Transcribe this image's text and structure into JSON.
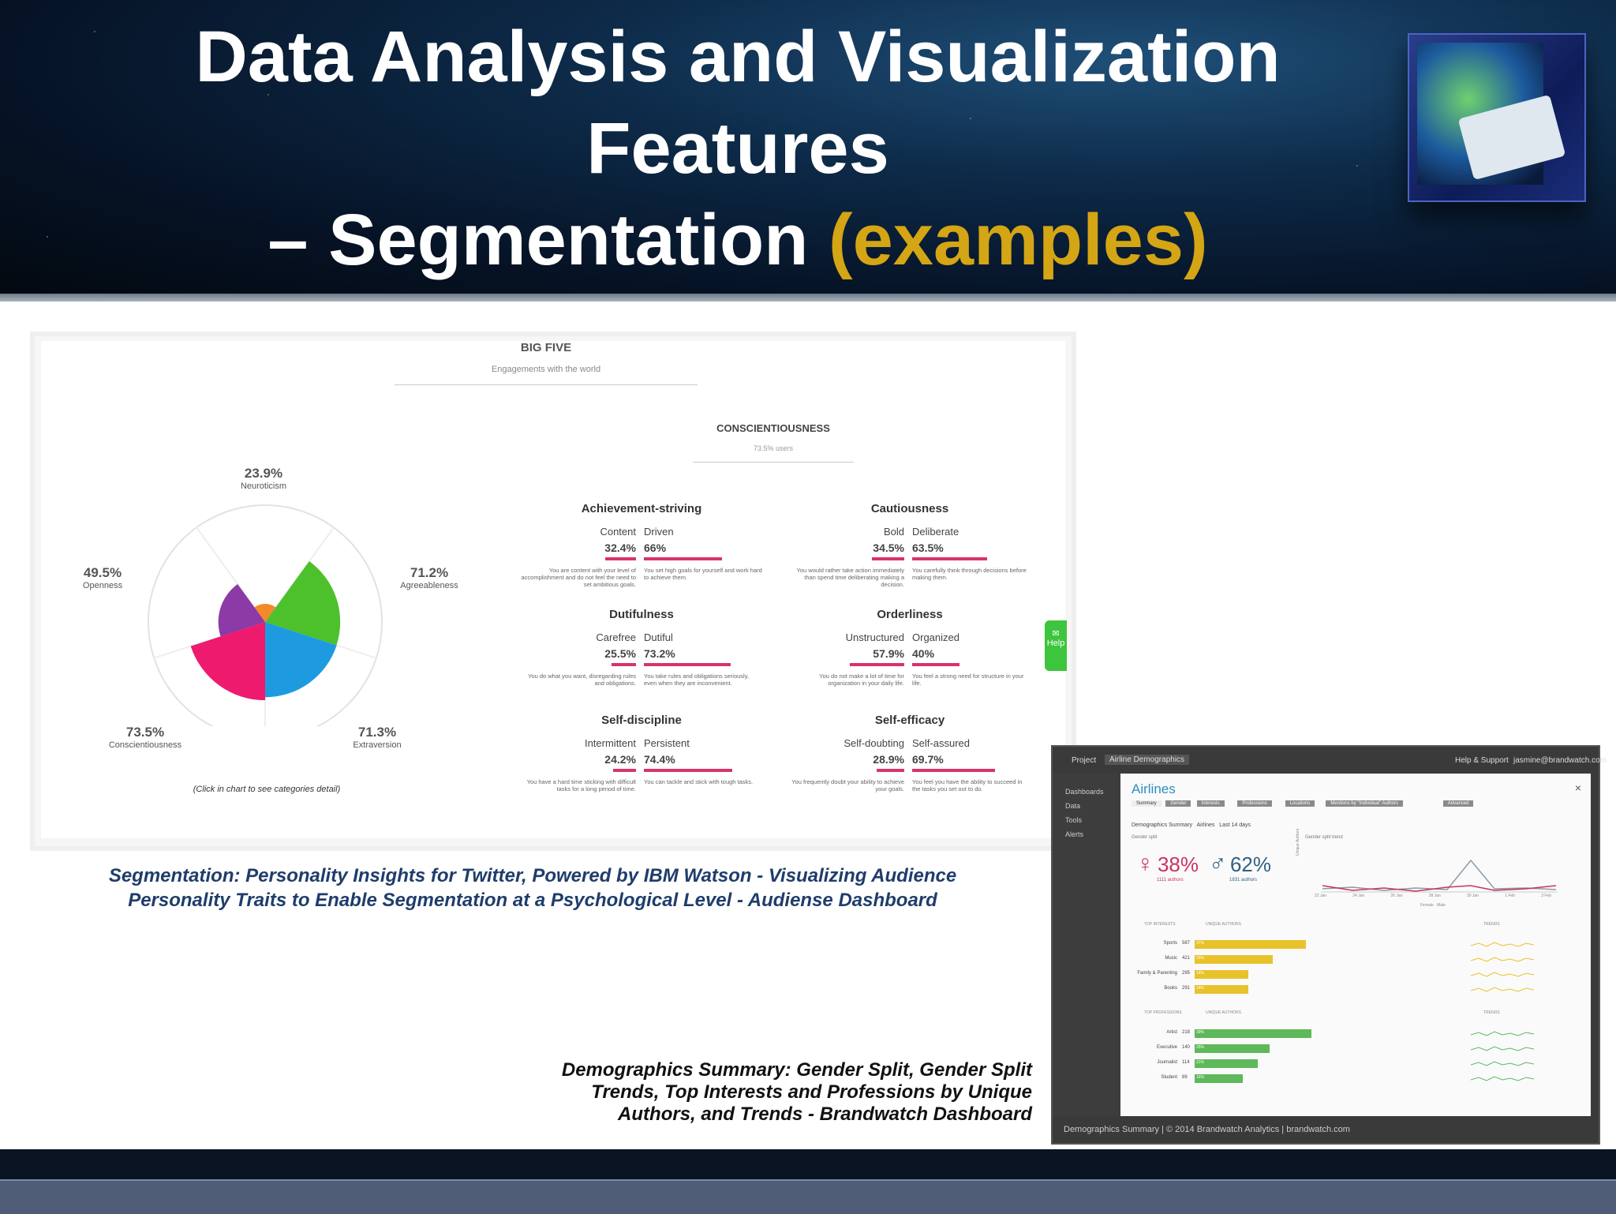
{
  "slide": {
    "title_line1": "Data Analysis and Visualization",
    "title_line2": "Features",
    "title_line3_prefix": "– Segmentation ",
    "title_line3_highlight": "(examples)",
    "highlight_color": "#d4a514"
  },
  "personality": {
    "header_title": "BIG FIVE",
    "header_subtitle": "Engagements with the world",
    "section_title": "CONSCIENTIOUSNESS",
    "section_subtitle": "73.5% users",
    "click_hint": "(Click in chart to see categories detail)",
    "help_label": "Help",
    "traits": [
      {
        "value": "23.9%",
        "name": "Neuroticism",
        "color": "#f28a2a"
      },
      {
        "value": "71.2%",
        "name": "Agreeableness",
        "color": "#4cc12b"
      },
      {
        "value": "71.3%",
        "name": "Extraversion",
        "color": "#1e9be0"
      },
      {
        "value": "73.5%",
        "name": "Conscientiousness",
        "color": "#ee1a6e"
      },
      {
        "value": "49.5%",
        "name": "Openness",
        "color": "#8c3aa6"
      }
    ],
    "facets": [
      {
        "title": "Achievement-striving",
        "left_label": "Content",
        "left_value": "32.4%",
        "right_label": "Driven",
        "right_value": "66%",
        "left_desc": "You are content with your level of accomplishment and do not feel the need to set ambitious goals.",
        "right_desc": "You set high goals for yourself and work hard to achieve them."
      },
      {
        "title": "Cautiousness",
        "left_label": "Bold",
        "left_value": "34.5%",
        "right_label": "Deliberate",
        "right_value": "63.5%",
        "left_desc": "You would rather take action immediately than spend time deliberating making a decision.",
        "right_desc": "You carefully think through decisions before making them."
      },
      {
        "title": "Dutifulness",
        "left_label": "Carefree",
        "left_value": "25.5%",
        "right_label": "Dutiful",
        "right_value": "73.2%",
        "left_desc": "You do what you want, disregarding rules and obligations.",
        "right_desc": "You take rules and obligations seriously, even when they are inconvenient."
      },
      {
        "title": "Orderliness",
        "left_label": "Unstructured",
        "left_value": "57.9%",
        "right_label": "Organized",
        "right_value": "40%",
        "left_desc": "You do not make a lot of time for organization in your daily life.",
        "right_desc": "You feel a strong need for structure in your life."
      },
      {
        "title": "Self-discipline",
        "left_label": "Intermittent",
        "left_value": "24.2%",
        "right_label": "Persistent",
        "right_value": "74.4%",
        "left_desc": "You have a hard time sticking with difficult tasks for a long period of time.",
        "right_desc": "You can tackle and stick with tough tasks."
      },
      {
        "title": "Self-efficacy",
        "left_label": "Self-doubting",
        "left_value": "28.9%",
        "right_label": "Self-assured",
        "right_value": "69.7%",
        "left_desc": "You frequently doubt your ability to achieve your goals.",
        "right_desc": "You feel you have the ability to succeed in the tasks you set out to do."
      }
    ]
  },
  "captions": {
    "segmentation_line1": "Segmentation: Personality Insights for Twitter, Powered by IBM Watson  - Visualizing Audience",
    "segmentation_line2": "Personality Traits to Enable Segmentation at a Psychological Level - Audiense Dashboard",
    "demographics_line1": "Demographics Summary: Gender Split, Gender Split",
    "demographics_line2": "Trends, Top Interests and Professions by Unique",
    "demographics_line3": "Authors, and Trends - Brandwatch Dashboard"
  },
  "brandwatch": {
    "project_label": "Project",
    "project_value": "Airline Demographics",
    "help_label": "Help & Support",
    "user_email": "jasmine@brandwatch.com",
    "nav": [
      "Dashboards",
      "Data",
      "Tools",
      "Alerts"
    ],
    "title": "Airlines",
    "tabs": [
      "Summary",
      "Gender",
      "Interests",
      "Professions",
      "Locations",
      "Mentions by \"Individual\" Authors",
      "Advanced"
    ],
    "filter_line": [
      "Demographics Summary",
      "Airlines",
      "Last 14 days"
    ],
    "gender_split_label": "Gender split",
    "gender_trend_label": "Gender split trend",
    "female_pct": "38%",
    "female_authors": "1111 authors",
    "male_pct": "62%",
    "male_authors": "1831 authors",
    "female_color": "#c9355f",
    "male_color": "#2f5f82",
    "trend_x": [
      "22 Jan",
      "24 Jan",
      "26 Jan",
      "28 Jan",
      "30 Jan",
      "1 Feb",
      "3 Feb"
    ],
    "trend_y_label": "Unique Authors",
    "trend_legend": [
      "Female",
      "Male"
    ],
    "interests_header": "TOP INTERESTS",
    "professions_header": "TOP PROFESSIONS",
    "unique_authors_header": "UNIQUE AUTHORS",
    "trends_header": "TRENDS",
    "interests": [
      {
        "name": "Sports",
        "count": "587",
        "pct": "37%",
        "share": 0.37
      },
      {
        "name": "Music",
        "count": "421",
        "pct": "26%",
        "share": 0.26
      },
      {
        "name": "Family & Parenting",
        "count": "295",
        "pct": "18%",
        "share": 0.18
      },
      {
        "name": "Books",
        "count": "291",
        "pct": "18%",
        "share": 0.18
      }
    ],
    "professions": [
      {
        "name": "Artist",
        "count": "218",
        "pct": "39%",
        "share": 0.39
      },
      {
        "name": "Executive",
        "count": "140",
        "pct": "25%",
        "share": 0.25
      },
      {
        "name": "Journalist",
        "count": "114",
        "pct": "21%",
        "share": 0.21
      },
      {
        "name": "Student",
        "count": "89",
        "pct": "16%",
        "share": 0.16
      }
    ],
    "interest_color": "#e8c22a",
    "profession_color": "#5fb85a",
    "footer_text": "Demographics Summary  |  © 2014 Brandwatch Analytics  |  brandwatch.com"
  }
}
